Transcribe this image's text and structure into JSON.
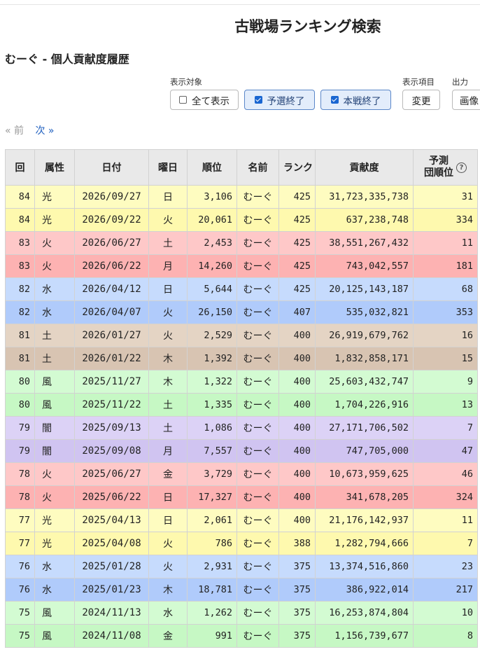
{
  "header": {
    "title": "古戦場ランキング検索",
    "subtitle": "むーぐ - 個人貢献度履歴"
  },
  "filters": {
    "target_label": "表示対象",
    "target_buttons": [
      {
        "label": "全て表示",
        "checked": false
      },
      {
        "label": "予選終了",
        "checked": true
      },
      {
        "label": "本戦終了",
        "checked": true
      }
    ],
    "items_label": "表示項目",
    "items_button": "変更",
    "output_label": "出力",
    "output_button": "画像"
  },
  "pager": {
    "prev": "« 前",
    "next": "次 »"
  },
  "table": {
    "headers": [
      "回",
      "属性",
      "日付",
      "曜日",
      "順位",
      "名前",
      "ランク",
      "貢献度",
      "予測\n団順位"
    ],
    "rows": [
      [
        "84",
        "光",
        "2026/09/27",
        "日",
        "3,106",
        "むーぐ",
        "425",
        "31,723,335,738",
        "31"
      ],
      [
        "84",
        "光",
        "2026/09/22",
        "火",
        "20,061",
        "むーぐ",
        "425",
        "637,238,748",
        "334"
      ],
      [
        "83",
        "火",
        "2026/06/27",
        "土",
        "2,453",
        "むーぐ",
        "425",
        "38,551,267,432",
        "11"
      ],
      [
        "83",
        "火",
        "2026/06/22",
        "月",
        "14,260",
        "むーぐ",
        "425",
        "743,042,557",
        "181"
      ],
      [
        "82",
        "水",
        "2026/04/12",
        "日",
        "5,644",
        "むーぐ",
        "425",
        "20,125,143,187",
        "68"
      ],
      [
        "82",
        "水",
        "2026/04/07",
        "火",
        "26,150",
        "むーぐ",
        "407",
        "535,032,821",
        "353"
      ],
      [
        "81",
        "土",
        "2026/01/27",
        "火",
        "2,529",
        "むーぐ",
        "400",
        "26,919,679,762",
        "16"
      ],
      [
        "81",
        "土",
        "2026/01/22",
        "木",
        "1,392",
        "むーぐ",
        "400",
        "1,832,858,171",
        "15"
      ],
      [
        "80",
        "風",
        "2025/11/27",
        "木",
        "1,322",
        "むーぐ",
        "400",
        "25,603,432,747",
        "9"
      ],
      [
        "80",
        "風",
        "2025/11/22",
        "土",
        "1,335",
        "むーぐ",
        "400",
        "1,704,226,916",
        "13"
      ],
      [
        "79",
        "闇",
        "2025/09/13",
        "土",
        "1,086",
        "むーぐ",
        "400",
        "27,171,706,502",
        "7"
      ],
      [
        "79",
        "闇",
        "2025/09/08",
        "月",
        "7,557",
        "むーぐ",
        "400",
        "747,705,000",
        "47"
      ],
      [
        "78",
        "火",
        "2025/06/27",
        "金",
        "3,729",
        "むーぐ",
        "400",
        "10,673,959,625",
        "46"
      ],
      [
        "78",
        "火",
        "2025/06/22",
        "日",
        "17,327",
        "むーぐ",
        "400",
        "341,678,205",
        "324"
      ],
      [
        "77",
        "光",
        "2025/04/13",
        "日",
        "2,061",
        "むーぐ",
        "400",
        "21,176,142,937",
        "11"
      ],
      [
        "77",
        "光",
        "2025/04/08",
        "火",
        "786",
        "むーぐ",
        "388",
        "1,282,794,666",
        "7"
      ],
      [
        "76",
        "水",
        "2025/01/28",
        "火",
        "2,931",
        "むーぐ",
        "375",
        "13,374,516,860",
        "23"
      ],
      [
        "76",
        "水",
        "2025/01/23",
        "木",
        "18,781",
        "むーぐ",
        "375",
        "386,922,014",
        "217"
      ],
      [
        "75",
        "風",
        "2024/11/13",
        "水",
        "1,262",
        "むーぐ",
        "375",
        "16,253,874,804",
        "10"
      ],
      [
        "75",
        "風",
        "2024/11/08",
        "金",
        "991",
        "むーぐ",
        "375",
        "1,156,739,677",
        "8"
      ]
    ],
    "row_colors": [
      "#fefcc0",
      "#fef9ae",
      "#fec8c8",
      "#fdb2b2",
      "#c6dbfd",
      "#b0cbfb",
      "#e4d4c4",
      "#d8c4b2",
      "#d3fbd2",
      "#c6f8c4",
      "#dcd2f6",
      "#d0c4f1",
      "#fec8c8",
      "#fdb2b2",
      "#fefcc0",
      "#fef9ae",
      "#c6dbfd",
      "#b0cbfb",
      "#d3fbd2",
      "#c6f8c4"
    ]
  }
}
